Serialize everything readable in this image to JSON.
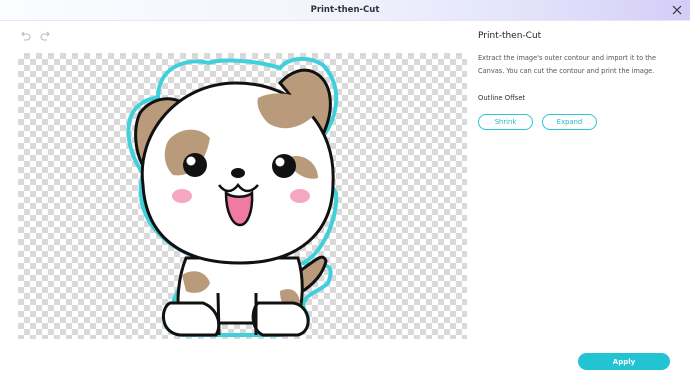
{
  "window": {
    "title": "Print-then-Cut"
  },
  "toolbar": {
    "undo_icon": "undo-icon",
    "redo_icon": "redo-icon"
  },
  "panel": {
    "title": "Print-then-Cut",
    "description": "Extract the image's outer contour and import it to the Canvas. You can cut the contour and print the image.",
    "offset_label": "Outline Offset",
    "shrink_label": "Shrink",
    "expand_label": "Expand",
    "apply_label": "Apply"
  },
  "colors": {
    "accent": "#22c3d3",
    "contour": "#3fd0dc",
    "fur_brown": "#b99a7b"
  }
}
